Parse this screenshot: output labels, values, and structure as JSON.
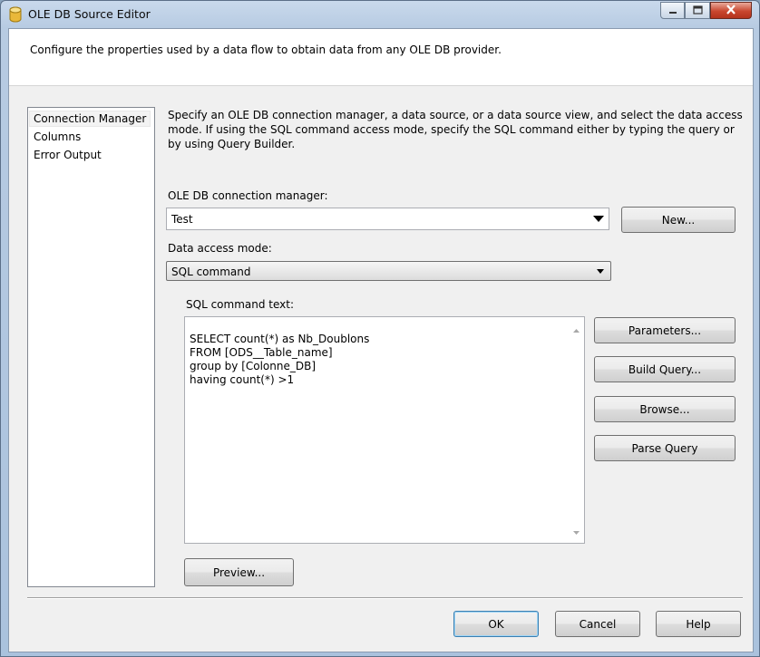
{
  "window": {
    "title": "OLE DB Source Editor"
  },
  "header": {
    "text": "Configure the properties used by a data flow to obtain data from any OLE DB provider."
  },
  "nav": {
    "items": [
      {
        "label": "Connection Manager",
        "selected": true
      },
      {
        "label": "Columns",
        "selected": false
      },
      {
        "label": "Error Output",
        "selected": false
      }
    ]
  },
  "main": {
    "description": "Specify an OLE DB connection manager, a data source, or a data source view, and select the data access mode. If using the SQL command access mode, specify the SQL command either by typing the query or by using Query Builder.",
    "connection_label": "OLE DB connection manager:",
    "connection_value": "Test",
    "new_button": "New...",
    "access_mode_label": "Data access mode:",
    "access_mode_value": "SQL command",
    "sql_label": "SQL command text:",
    "sql_text": "SELECT count(*) as Nb_Doublons\nFROM [ODS__Table_name]\ngroup by [Colonne_DB]\nhaving count(*) >1",
    "parameters_button": "Parameters...",
    "build_query_button": "Build Query...",
    "browse_button": "Browse...",
    "parse_query_button": "Parse Query",
    "preview_button": "Preview..."
  },
  "footer": {
    "ok": "OK",
    "cancel": "Cancel",
    "help": "Help"
  },
  "icons": {
    "title_icon": "database-cylinder-icon",
    "minimize": "minimize-icon",
    "maximize": "maximize-icon",
    "close": "close-icon"
  }
}
